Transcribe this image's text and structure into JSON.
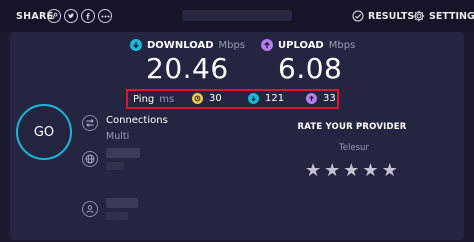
{
  "header": {
    "share_label": "SHARE",
    "share_buttons": [
      {
        "icon": "link-icon",
        "glyph": "🔗"
      },
      {
        "icon": "twitter-icon",
        "glyph": "t"
      },
      {
        "icon": "facebook-icon",
        "glyph": "f"
      },
      {
        "icon": "more-icon",
        "glyph": "•••"
      }
    ],
    "results_label": "RESULTS",
    "settings_label": "SETTINGS"
  },
  "download": {
    "label": "DOWNLOAD",
    "unit": "Mbps",
    "value": "20.46",
    "icon": "download-arrow-icon",
    "color": "#1ab8d6"
  },
  "upload": {
    "label": "UPLOAD",
    "unit": "Mbps",
    "value": "6.08",
    "icon": "upload-arrow-icon",
    "color": "#b47cf0"
  },
  "ping": {
    "label": "Ping",
    "unit": "ms",
    "idle": {
      "value": "30",
      "color": "#f0c75a",
      "icon": "idle-latency-icon"
    },
    "download": {
      "value": "121",
      "color": "#1ab8d6",
      "icon": "download-latency-icon"
    },
    "upload": {
      "value": "33",
      "color": "#b47cf0",
      "icon": "upload-latency-icon"
    }
  },
  "go_label": "GO",
  "connections": {
    "title": "Connections",
    "mode": "Multi"
  },
  "rating": {
    "title": "RATE YOUR PROVIDER",
    "provider": "Telesur",
    "stars": 5,
    "star_glyph": "★"
  },
  "colors": {
    "background": "#1a1b2e",
    "panel": "#242540",
    "accent": "#1ab8d6",
    "highlight": "#e0162b"
  }
}
